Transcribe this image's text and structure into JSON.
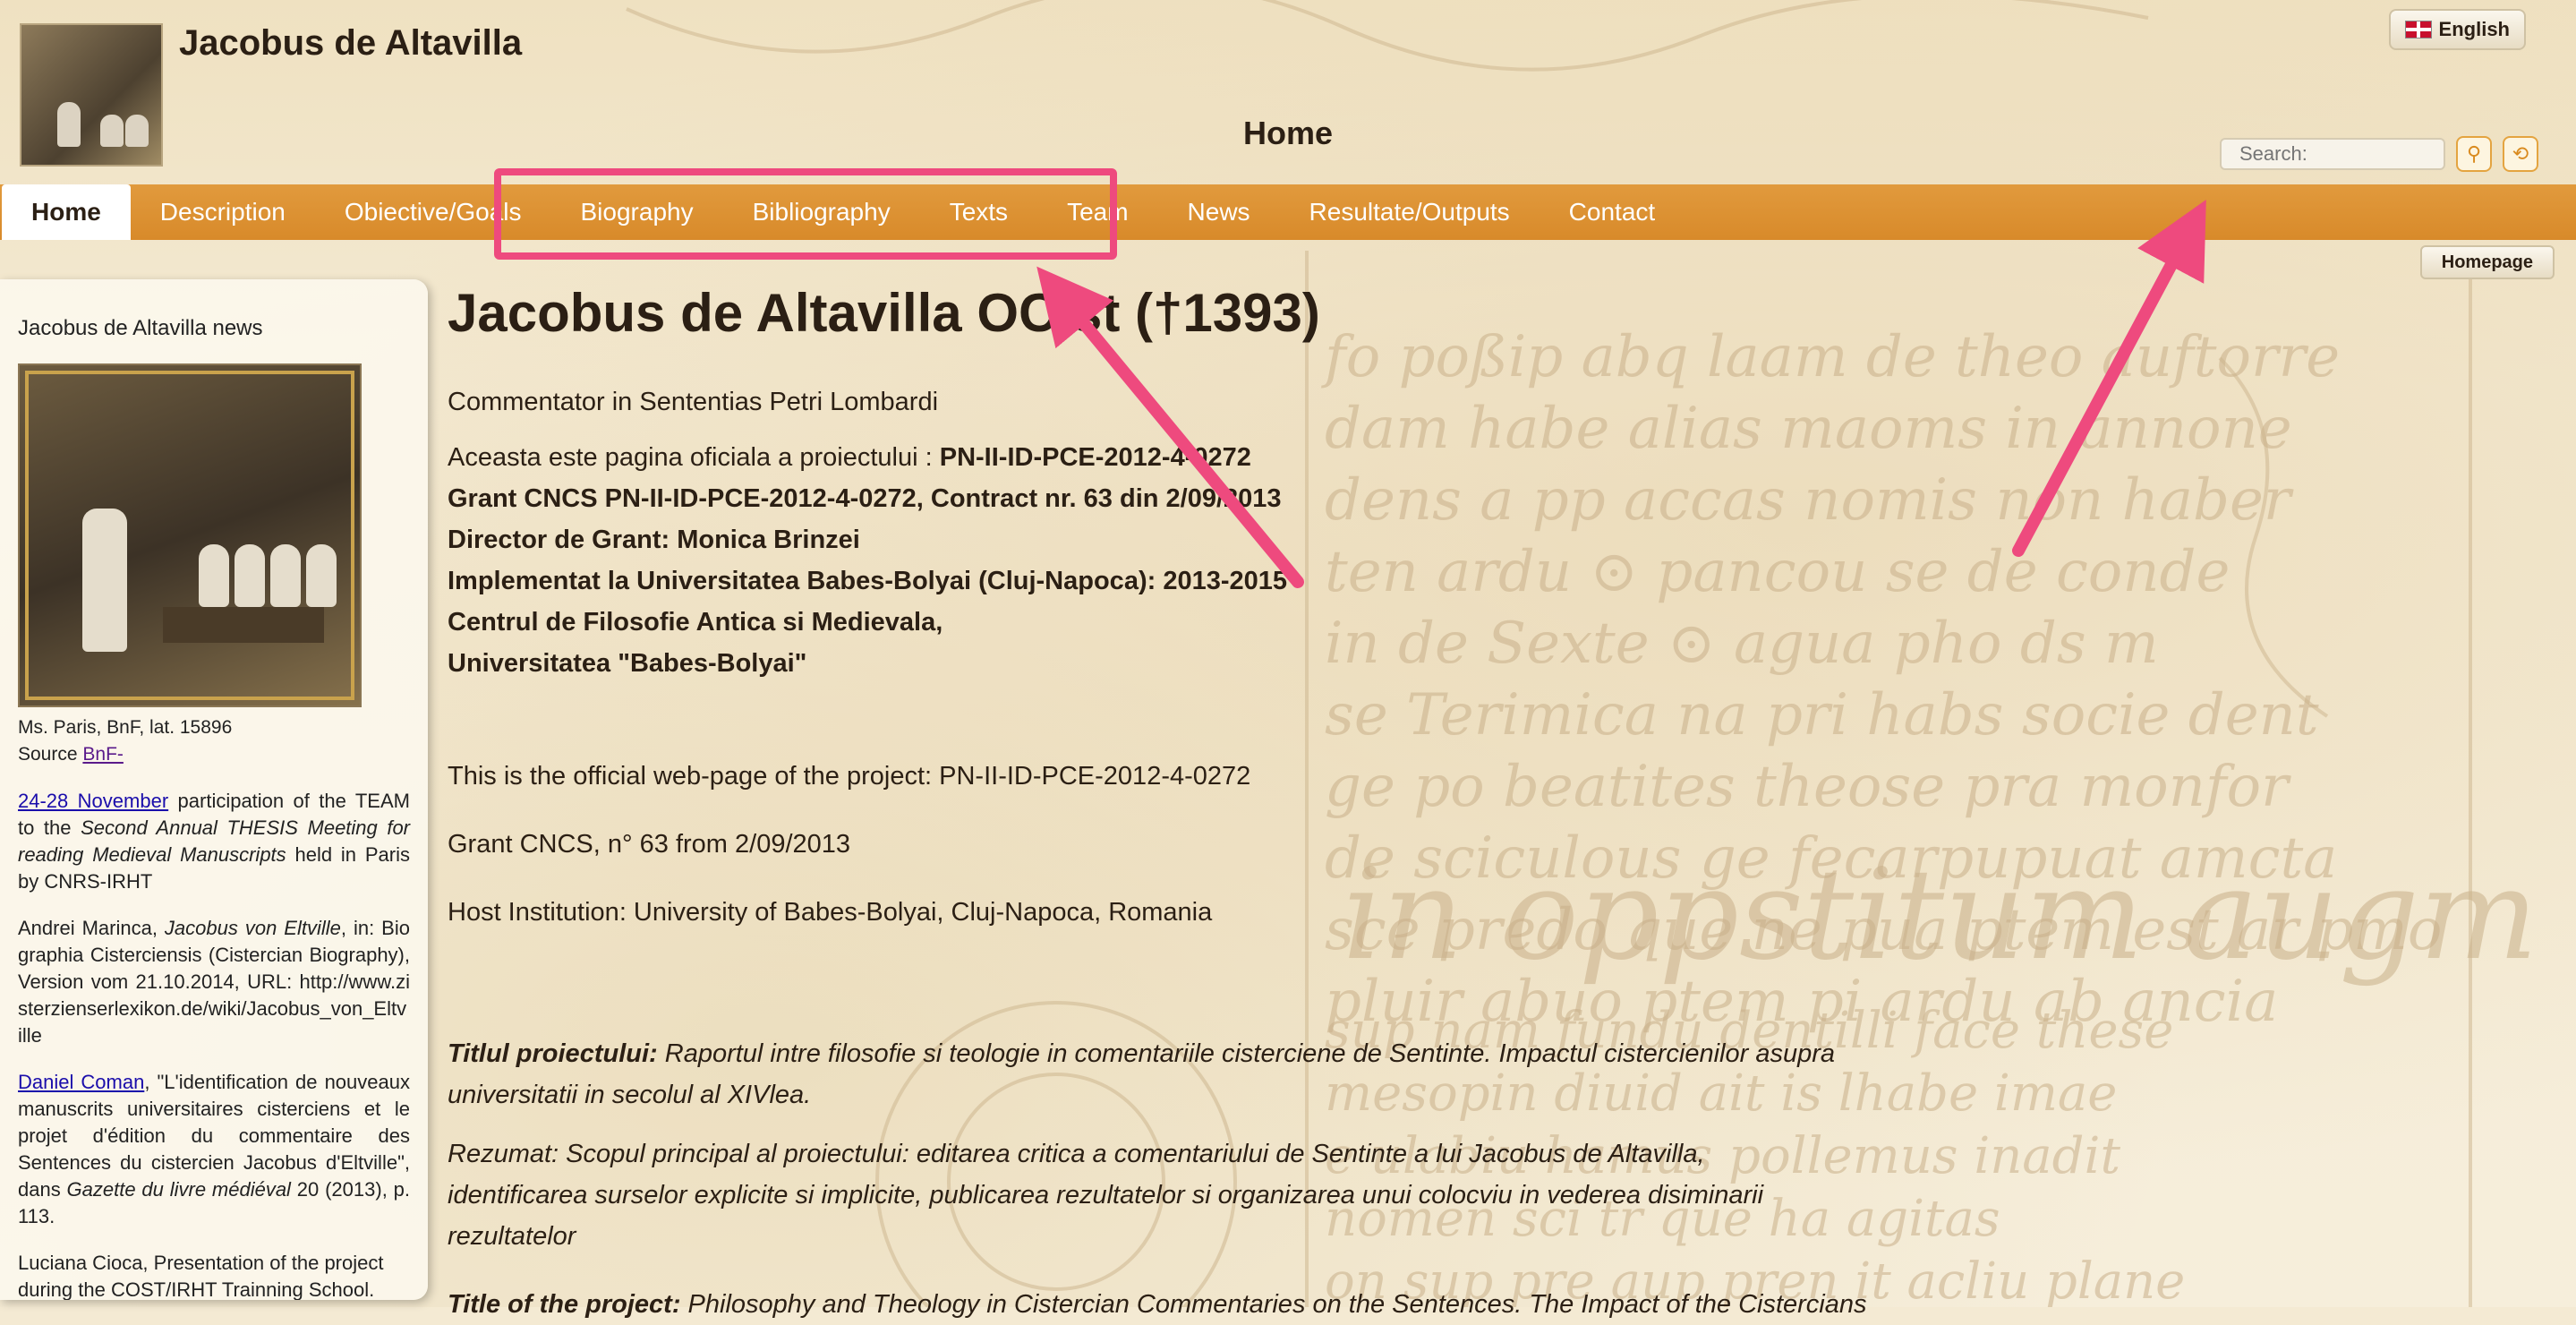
{
  "header": {
    "site_title": "Jacobus de Altavilla",
    "page_heading": "Home",
    "language_label": "English",
    "search_placeholder": "Search:",
    "homepage_label": "Homepage"
  },
  "nav": {
    "items": [
      "Home",
      "Description",
      "Obiective/Goals",
      "Biography",
      "Bibliography",
      "Texts",
      "Team",
      "News",
      "Resultate/Outputs",
      "Contact"
    ],
    "active": "Home"
  },
  "sidebar": {
    "title": "Jacobus de Altavilla news",
    "caption_line1": "Ms. Paris, BnF, lat. 15896",
    "caption_source": "Source",
    "caption_link": "BnF-",
    "news1_link": "24-28 November",
    "news1_a": " participation of the TEAM to the ",
    "news1_b": "Second Annual THESIS Meeting for reading Medieval Manuscripts",
    "news1_c": " held in Paris by CNRS-IRHT",
    "news2_a": "Andrei Marinca, ",
    "news2_b": "Jacobus von Eltville",
    "news2_c": ", in: Biographia Cisterciensis (Cistercian Biography), Version vom 21.10.2014, URL: http://www.zisterzienserlexikon.de/wiki/Jacobus_von_Eltville",
    "news3_link": "Daniel Coman",
    "news3_a": ", \"L'identification de nouveaux manuscrits universitaires cisterciens et le projet d'édition du commentaire des Sentences du cistercien Jacobus d'Eltville\", dans ",
    "news3_b": "Gazette du livre médiéval",
    "news3_c": " 20 (2013), p. 113.",
    "news4": "Luciana Cioca, Presentation of the project during the COST/IRHT Trainning School. Transmission of texts. New tools new"
  },
  "main": {
    "title": "Jacobus de Altavilla OCist (†1393)",
    "subtitle": "Commentator in Sententias Petri Lombardi",
    "line1_prefix": "Aceasta este pagina oficiala a proiectului : ",
    "line1_code": "PN-II-ID-PCE-2012-4-0272",
    "line2": "Grant CNCS PN-II-ID-PCE-2012-4-0272, Contract nr. 63 din 2/09/2013",
    "line3": "Director de Grant: Monica Brinzei",
    "line4": "Implementat la Universitatea Babes-Bolyai (Cluj-Napoca): 2013-2015",
    "line5": "Centrul de Filosofie Antica si Medievala,",
    "line6": "Universitatea \"Babes-Bolyai\"",
    "en1": "This is the official web-page of the project: PN-II-ID-PCE-2012-4-0272",
    "en2": "Grant CNCS, n° 63 from 2/09/2013",
    "en3": "Host Institution: University of Babes-Bolyai, Cluj-Napoca, Romania",
    "titlu_label": "Titlul proiectului:",
    "titlu_text": " Raportul intre filosofie si teologie in comentariile cisterciene de Sentinte. Impactul cistercienilor asupra universitatii in secolul al XIVlea.",
    "rezumat": "Rezumat:  Scopul principal al proiectului: editarea critica a comentariului de Sentinte a lui Jacobus de Altavilla, identificarea surselor explicite si implicite, publicarea rezultatelor si organizarea unui colocviu in vederea disiminarii rezultatelor",
    "title_en_label": "Title of the project:",
    "title_en_text": " Philosophy and Theology in Cistercian Commentaries on the Sentences. The Impact of the Cistercians"
  },
  "colors": {
    "nav_orange": "#dd9233",
    "highlight_pink": "#ee4a7e",
    "parchment": "#f4ead3"
  }
}
